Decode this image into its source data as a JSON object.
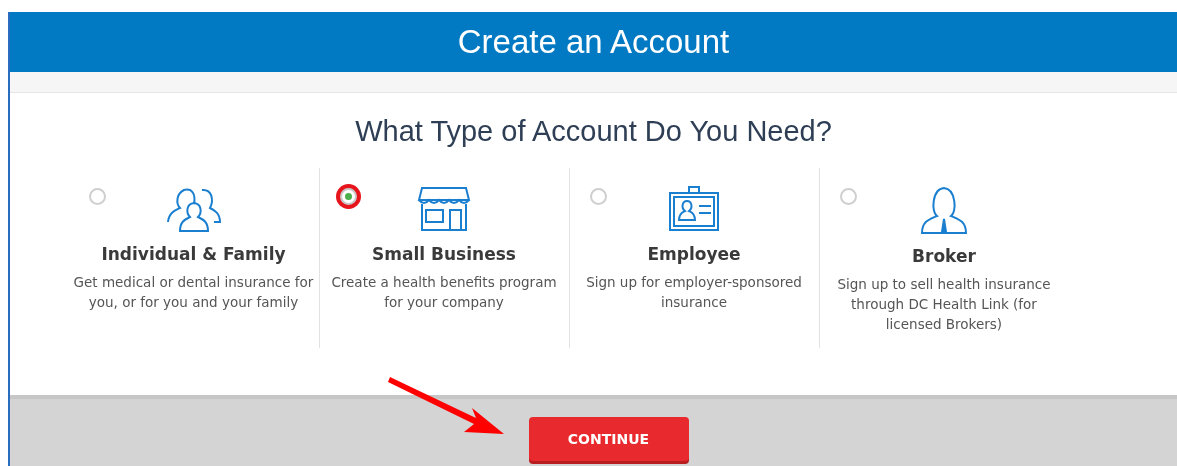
{
  "header": {
    "title": "Create an Account"
  },
  "heading": "What Type of Account Do You Need?",
  "account_types": [
    {
      "title": "Individual & Family",
      "description": "Get medical or dental insurance for you, or for you and your family",
      "selected": false
    },
    {
      "title": "Small Business",
      "description": "Create a health benefits program for your company",
      "selected": true
    },
    {
      "title": "Employee",
      "description": "Sign up for employer-sponsored insurance",
      "selected": false
    },
    {
      "title": "Broker",
      "description": "Sign up to sell health insurance through DC Health Link (for licensed Brokers)",
      "selected": false
    }
  ],
  "continue_button": "CONTINUE"
}
